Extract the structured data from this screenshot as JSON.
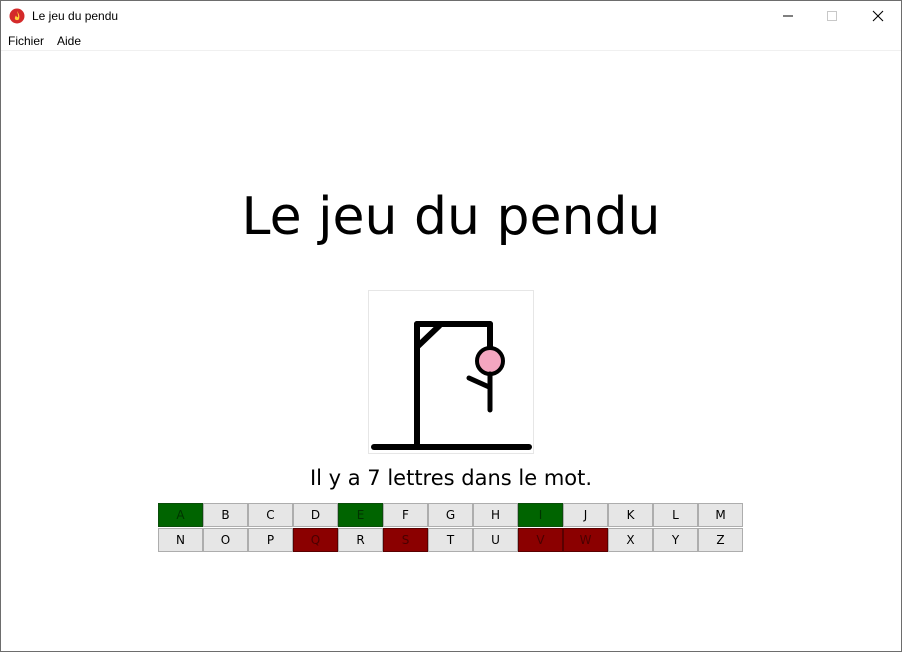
{
  "window": {
    "title": "Le jeu du pendu",
    "controls": {
      "minimize": "minimize-icon",
      "maximize": "maximize-icon",
      "close": "close-icon"
    }
  },
  "menu": {
    "items": [
      "Fichier",
      "Aide"
    ]
  },
  "game": {
    "title": "Le jeu du pendu",
    "status": "Il y a 7 lettres dans le mot."
  },
  "keyboard": {
    "rows": [
      [
        {
          "letter": "A",
          "state": "correct"
        },
        {
          "letter": "B",
          "state": "unused"
        },
        {
          "letter": "C",
          "state": "unused"
        },
        {
          "letter": "D",
          "state": "unused"
        },
        {
          "letter": "E",
          "state": "correct"
        },
        {
          "letter": "F",
          "state": "unused"
        },
        {
          "letter": "G",
          "state": "unused"
        },
        {
          "letter": "H",
          "state": "unused"
        },
        {
          "letter": "I",
          "state": "correct"
        },
        {
          "letter": "J",
          "state": "unused"
        },
        {
          "letter": "K",
          "state": "unused"
        },
        {
          "letter": "L",
          "state": "unused"
        },
        {
          "letter": "M",
          "state": "unused"
        }
      ],
      [
        {
          "letter": "N",
          "state": "unused"
        },
        {
          "letter": "O",
          "state": "unused"
        },
        {
          "letter": "P",
          "state": "unused"
        },
        {
          "letter": "Q",
          "state": "wrong"
        },
        {
          "letter": "R",
          "state": "unused"
        },
        {
          "letter": "S",
          "state": "wrong"
        },
        {
          "letter": "T",
          "state": "unused"
        },
        {
          "letter": "U",
          "state": "unused"
        },
        {
          "letter": "V",
          "state": "wrong"
        },
        {
          "letter": "W",
          "state": "wrong"
        },
        {
          "letter": "X",
          "state": "unused"
        },
        {
          "letter": "Y",
          "state": "unused"
        },
        {
          "letter": "Z",
          "state": "unused"
        }
      ]
    ]
  },
  "colors": {
    "correct": "#006400",
    "wrong": "#8b0000",
    "unused": "#e6e6e6",
    "head": "#f4a6c0"
  }
}
